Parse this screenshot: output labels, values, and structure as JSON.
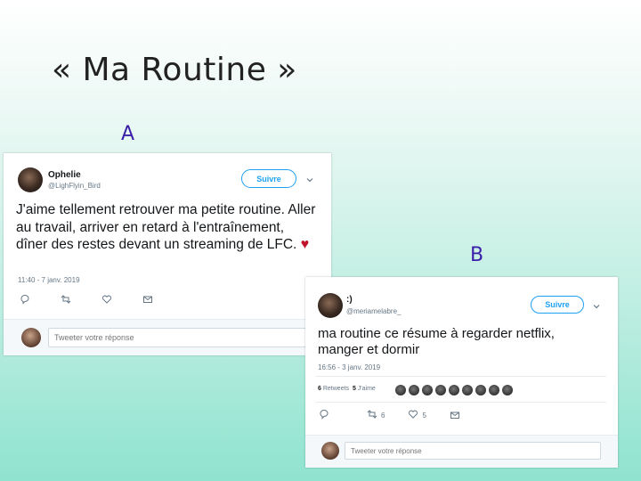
{
  "slide": {
    "title": "« Ma Routine »",
    "label_a": "A",
    "label_b": "B"
  },
  "tweet_a": {
    "name": "Ophelie",
    "handle": "@LighFlyin_Bird",
    "follow_label": "Suivre",
    "text": "J'aime tellement retrouver ma petite routine. Aller au travail, arriver en retard à l'entraînement, dîner des restes devant un streaming de LFC.",
    "heart": "♥",
    "time": "11:40 - 7 janv. 2019",
    "reply_placeholder": "Tweeter votre réponse"
  },
  "tweet_b": {
    "name": ":)",
    "handle": "@meriamelabre_",
    "follow_label": "Suivre",
    "text": "ma routine ce résume à regarder netflix, manger et dormir",
    "time": "16:56 - 3 janv. 2019",
    "retweets_count": "6",
    "retweets_label": "Retweets",
    "likes_count": "5",
    "likes_label": "J'aime",
    "reply_count": "",
    "retweet_action_count": "6",
    "like_action_count": "5",
    "reply_placeholder": "Tweeter votre réponse"
  },
  "icons": {
    "reply": "reply-icon",
    "retweet": "retweet-icon",
    "like": "heart-icon",
    "message": "mail-icon",
    "chevron": "chevron-down-icon"
  },
  "colors": {
    "accent": "#1da1f2",
    "heart": "#c0152a",
    "label": "#3b1fa8"
  }
}
